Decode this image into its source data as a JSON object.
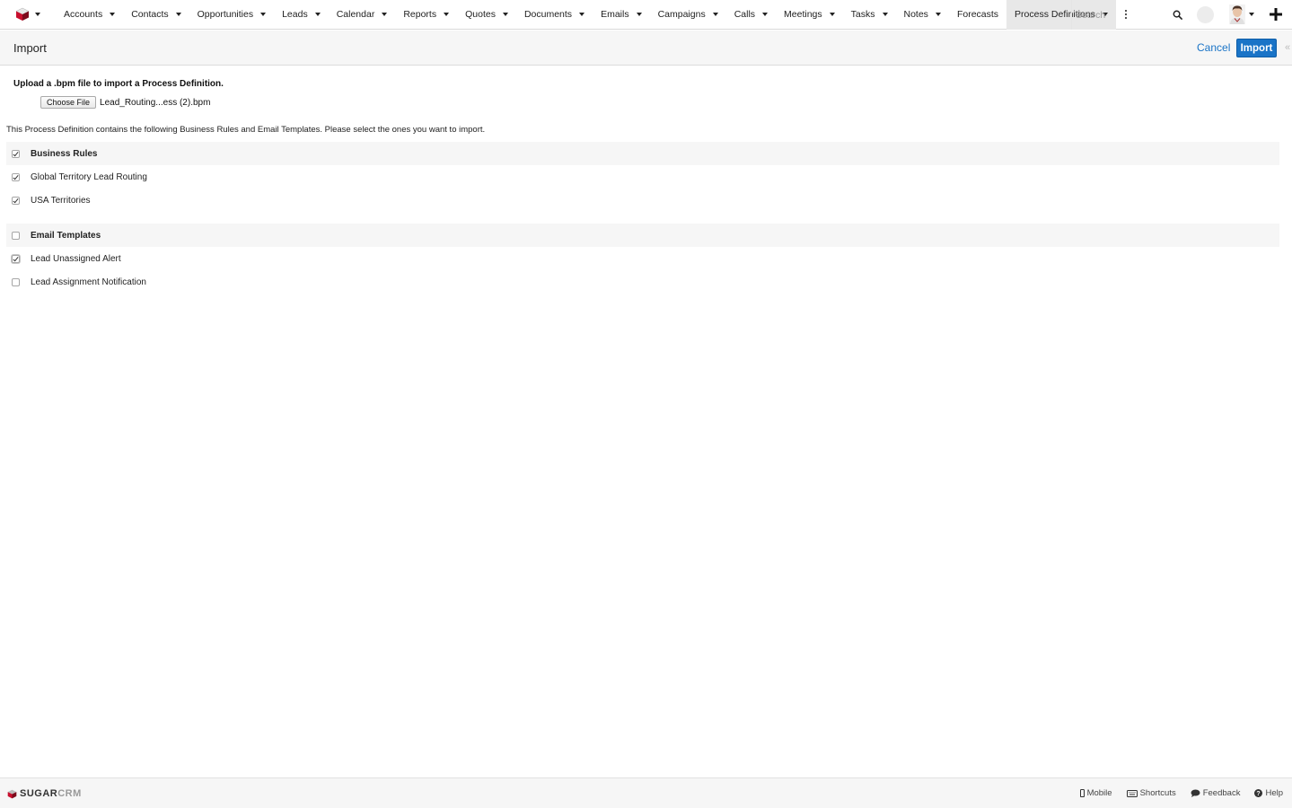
{
  "nav": {
    "items": [
      {
        "label": "Accounts",
        "dropdown": true
      },
      {
        "label": "Contacts",
        "dropdown": true
      },
      {
        "label": "Opportunities",
        "dropdown": true
      },
      {
        "label": "Leads",
        "dropdown": true
      },
      {
        "label": "Calendar",
        "dropdown": true
      },
      {
        "label": "Reports",
        "dropdown": true
      },
      {
        "label": "Quotes",
        "dropdown": true
      },
      {
        "label": "Documents",
        "dropdown": true
      },
      {
        "label": "Emails",
        "dropdown": true
      },
      {
        "label": "Campaigns",
        "dropdown": true
      },
      {
        "label": "Calls",
        "dropdown": true
      },
      {
        "label": "Meetings",
        "dropdown": true
      },
      {
        "label": "Tasks",
        "dropdown": true
      },
      {
        "label": "Notes",
        "dropdown": true
      },
      {
        "label": "Forecasts",
        "dropdown": false
      },
      {
        "label": "Process Definitions",
        "dropdown": true,
        "active": true
      }
    ],
    "search_placeholder": "Search"
  },
  "header": {
    "title": "Import",
    "cancel_label": "Cancel",
    "import_label": "Import"
  },
  "upload": {
    "label": "Upload a .bpm file to import a Process Definition.",
    "choose_label": "Choose File",
    "file_name": "Lead_Routing...ess (2).bpm"
  },
  "description": "This Process Definition contains the following Business Rules and Email Templates. Please select the ones you want to import.",
  "groups": [
    {
      "title": "Business Rules",
      "checked": true,
      "items": [
        {
          "label": "Global Territory Lead Routing",
          "checked": true
        },
        {
          "label": "USA Territories",
          "checked": true
        }
      ]
    },
    {
      "title": "Email Templates",
      "checked": false,
      "items": [
        {
          "label": "Lead Unassigned Alert",
          "checked": true,
          "focused": true
        },
        {
          "label": "Lead Assignment Notification",
          "checked": false
        }
      ]
    }
  ],
  "footer": {
    "brand_main": "SUGAR",
    "brand_light": "CRM",
    "links": [
      "Mobile",
      "Shortcuts",
      "Feedback",
      "Help"
    ]
  },
  "colors": {
    "accent": "#1a74c7",
    "logo_red": "#c8102e"
  }
}
